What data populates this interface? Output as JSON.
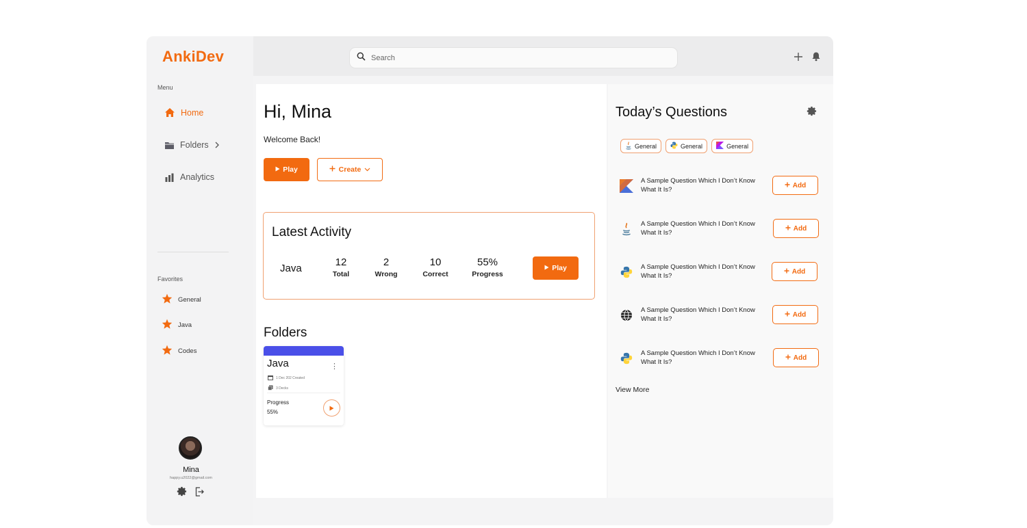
{
  "app": {
    "name": "AnkiDev",
    "brand_color": "#f26a10"
  },
  "sidebar": {
    "menu_label": "Menu",
    "items": [
      {
        "label": "Home",
        "icon": "home-icon",
        "active": true
      },
      {
        "label": "Folders",
        "icon": "folder-icon",
        "has_chevron": true
      },
      {
        "label": "Analytics",
        "icon": "bar-chart-icon"
      }
    ],
    "favorites_label": "Favorites",
    "favorites": [
      {
        "label": "General",
        "icon": "star-icon"
      },
      {
        "label": "Java",
        "icon": "star-icon"
      },
      {
        "label": "Codes",
        "icon": "star-icon"
      }
    ],
    "user": {
      "name": "Mina",
      "email": "happy.u2022@gmail.com"
    }
  },
  "topbar": {
    "search_placeholder": "Search"
  },
  "main": {
    "greeting": "Hi, Mina",
    "welcome": "Welcome Back!",
    "play_label": "Play",
    "create_label": "Create",
    "latest_activity": {
      "title": "Latest Activity",
      "language": "Java",
      "stats": [
        {
          "value": "12",
          "label": "Total"
        },
        {
          "value": "2",
          "label": "Wrong"
        },
        {
          "value": "10",
          "label": "Correct"
        },
        {
          "value": "55%",
          "label": "Progress"
        }
      ],
      "play_label": "Play"
    },
    "folders_title": "Folders",
    "folder": {
      "name": "Java",
      "created": "1 Dec 202 Created",
      "decks": "3 Decks",
      "progress_label": "Progress",
      "progress_value": "55%",
      "band_color": "#4a4fe8"
    }
  },
  "right": {
    "title": "Today’s Questions",
    "chips": [
      {
        "label": "General",
        "icon": "java-icon"
      },
      {
        "label": "General",
        "icon": "python-icon"
      },
      {
        "label": "General",
        "icon": "kotlin-icon"
      }
    ],
    "questions": [
      {
        "text": "A Sample Question Which I Don’t Know What It Is?",
        "icon": "kotlin-icon",
        "add_label": "Add"
      },
      {
        "text": "A Sample Question Which I Don’t Know What It Is?",
        "icon": "java-icon",
        "add_label": "Add"
      },
      {
        "text": "A Sample Question Which I Don’t Know What It Is?",
        "icon": "python-icon",
        "add_label": "Add"
      },
      {
        "text": "A Sample Question Which I Don’t Know What It Is?",
        "icon": "globe-icon",
        "add_label": "Add"
      },
      {
        "text": "A Sample Question Which I Don’t Know What It Is?",
        "icon": "python-icon",
        "add_label": "Add"
      }
    ],
    "view_more": "View More"
  }
}
